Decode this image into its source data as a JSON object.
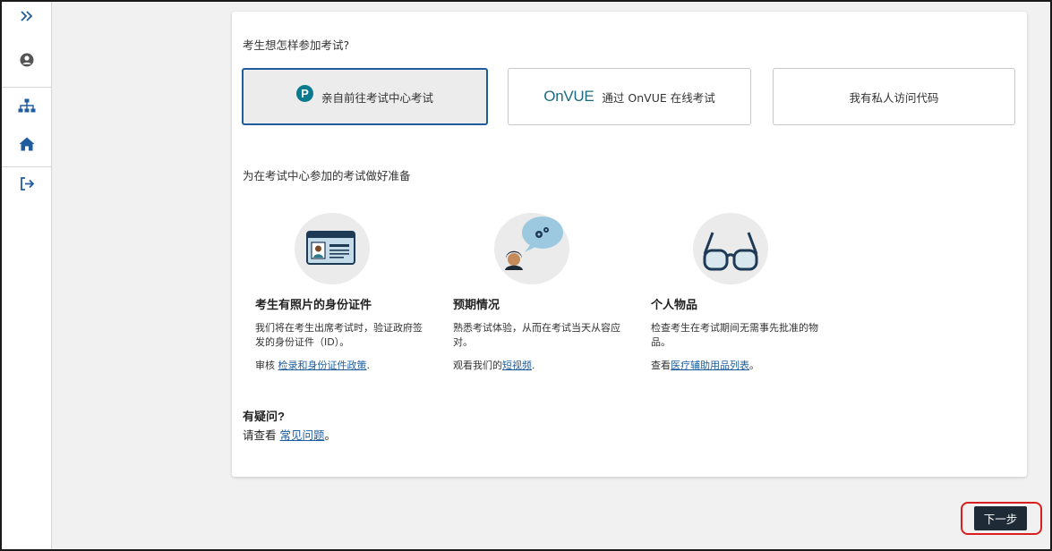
{
  "sidebar": {
    "items": [
      {
        "icon": "expand-chevrons-icon",
        "label": "»"
      },
      {
        "icon": "user-account-icon"
      },
      {
        "icon": "sitemap-icon"
      },
      {
        "icon": "home-icon"
      },
      {
        "icon": "sign-out-icon"
      }
    ]
  },
  "question": {
    "title": "考生想怎样参加考试?"
  },
  "options": [
    {
      "label": "亲自前往考试中心考试",
      "logo": "P",
      "selected": true
    },
    {
      "label": "通过 OnVUE 在线考试",
      "logo": "OnVUE",
      "selected": false
    },
    {
      "label": "我有私人访问代码",
      "selected": false
    }
  ],
  "prep": {
    "title": "为在考试中心参加的考试做好准备",
    "items": [
      {
        "icon": "id-card-icon",
        "heading": "考生有照片的身份证件",
        "text": "我们将在考生出席考试时，验证政府签发的身份证件（ID）。",
        "link_prefix": "审核 ",
        "link_text": "检录和身份证件政策",
        "link_suffix": "."
      },
      {
        "icon": "person-thinking-icon",
        "heading": "预期情况",
        "text": "熟悉考试体验，从而在考试当天从容应对。",
        "link_prefix": "观看我们的",
        "link_text": "短视频",
        "link_suffix": "."
      },
      {
        "icon": "glasses-icon",
        "heading": "个人物品",
        "text": "检查考生在考试期间无需事先批准的物品。",
        "link_prefix": "查看",
        "link_text": "医疗辅助用品列表",
        "link_suffix": "。"
      }
    ]
  },
  "faq": {
    "heading": "有疑问?",
    "prefix": "请查看 ",
    "link_text": "常见问题",
    "suffix": "。"
  },
  "footer": {
    "next_label": "下一步"
  },
  "colors": {
    "accent": "#1f5d9e",
    "next_bg": "#1e2a36",
    "highlight_border": "#d9201f",
    "pearson_teal": "#0a7a8c"
  }
}
